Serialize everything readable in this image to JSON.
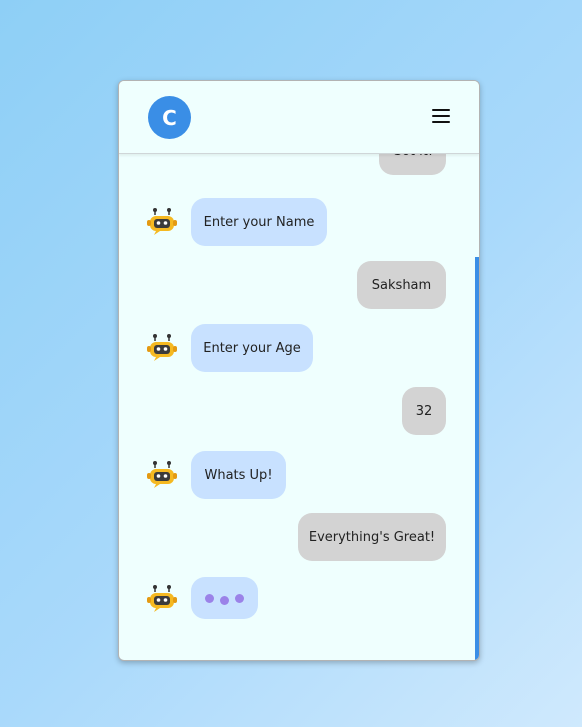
{
  "header": {
    "logo_letter": "C",
    "menu_icon": "hamburger-menu-icon"
  },
  "messages": [
    {
      "sender": "user",
      "text": "Got it!"
    },
    {
      "sender": "bot",
      "text": "Enter your Name",
      "avatar_icon": "robot-icon"
    },
    {
      "sender": "user",
      "text": "Saksham"
    },
    {
      "sender": "bot",
      "text": "Enter your Age",
      "avatar_icon": "robot-icon"
    },
    {
      "sender": "user",
      "text": "32"
    },
    {
      "sender": "bot",
      "text": "Whats Up!",
      "avatar_icon": "robot-icon"
    },
    {
      "sender": "user",
      "text": "Everything's Great!"
    },
    {
      "sender": "bot",
      "typing": true,
      "avatar_icon": "robot-icon"
    }
  ],
  "colors": {
    "page_background_start": "#8ecff6",
    "page_background_end": "#cfe9fd",
    "chat_background": "#effffe",
    "logo": "#3a8ee6",
    "bot_bubble": "#c8e1ff",
    "user_bubble": "#d3d3d3",
    "typing_dots": "#9b82e8",
    "scrollbar": "#3a8ee6"
  }
}
